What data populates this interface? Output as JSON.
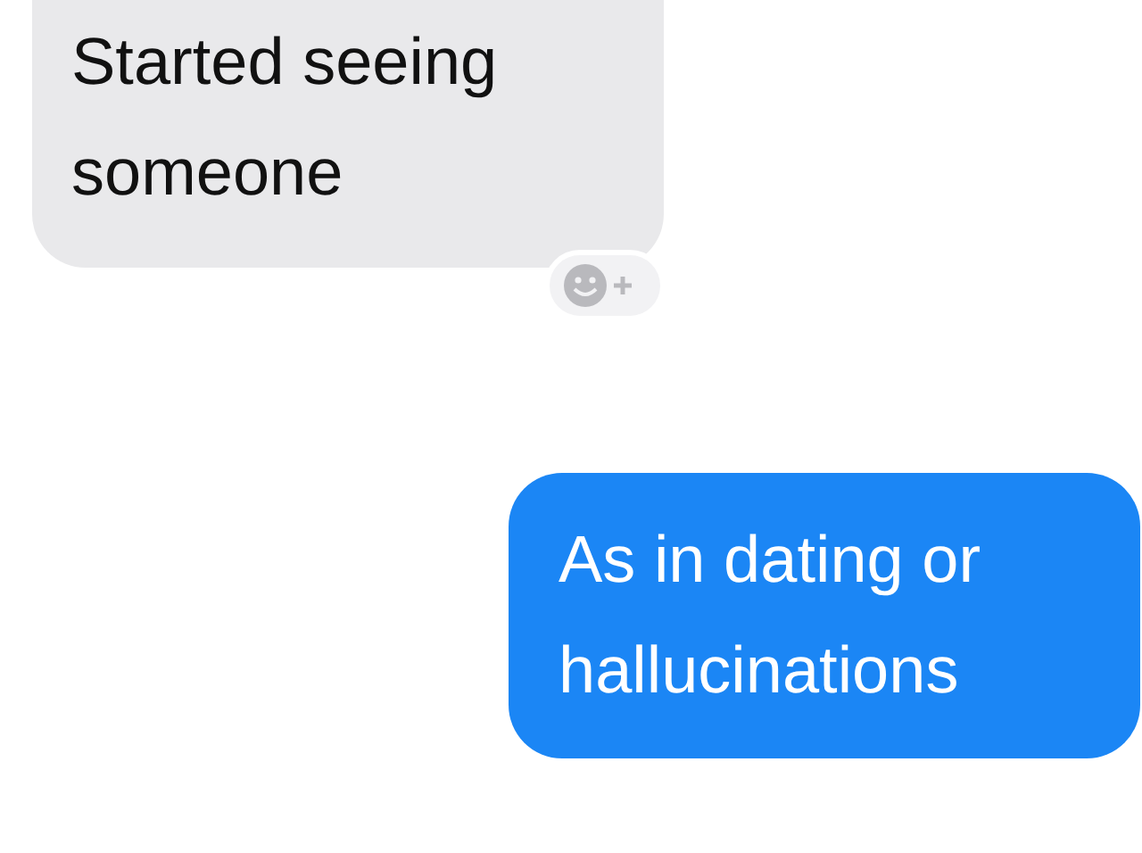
{
  "messages": [
    {
      "kind": "incoming",
      "text": "Started seeing someone",
      "reaction_button": true
    },
    {
      "kind": "outgoing",
      "text": "As in dating or hallucinations",
      "reaction_button": false
    }
  ]
}
